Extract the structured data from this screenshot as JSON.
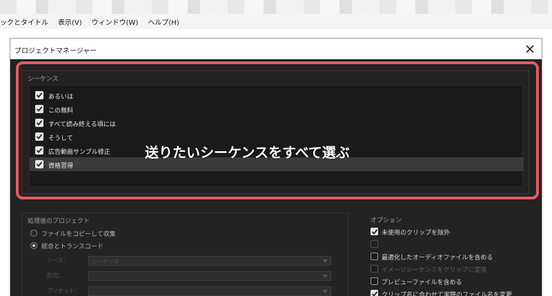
{
  "menu": {
    "items": [
      "ックとタイトル",
      "表示(V)",
      "ウィンドウ(W)",
      "ヘルプ(H)"
    ]
  },
  "dialog": {
    "title": "プロジェクトマネージャー",
    "sequence_group": {
      "title": "シーケンス",
      "items": [
        {
          "label": "あるいは",
          "checked": true,
          "selected": false
        },
        {
          "label": "この無料",
          "checked": true,
          "selected": false
        },
        {
          "label": "すべて読み終える頃には",
          "checked": true,
          "selected": false
        },
        {
          "label": "そうして",
          "checked": true,
          "selected": false
        },
        {
          "label": "広告動画サンプル修正",
          "checked": true,
          "selected": false
        },
        {
          "label": "資格習得",
          "checked": true,
          "selected": true
        }
      ]
    },
    "project_group": {
      "title": "処理後のプロジェクト",
      "radios": [
        {
          "label": "ファイルをコピーして収集",
          "selected": false
        },
        {
          "label": "統合とトランスコード",
          "selected": true
        }
      ],
      "fields": [
        {
          "label": "ソース：",
          "value": "シーケンス"
        },
        {
          "label": "形式：",
          "value": ""
        },
        {
          "label": "プリセット：",
          "value": ""
        }
      ]
    },
    "options_group": {
      "title": "オプション",
      "items": [
        {
          "label": "未使用のクリップを除外",
          "checked": true,
          "enabled": true
        },
        {
          "label": "",
          "checked": false,
          "enabled": false
        },
        {
          "label": "最適化したオーディオファイルを含める",
          "checked": false,
          "enabled": true
        },
        {
          "label": "イメージシーケンスをクリップに変換",
          "checked": false,
          "enabled": false
        },
        {
          "label": "プレビューファイルを含める",
          "checked": false,
          "enabled": true
        },
        {
          "label": "クリップ名に合わせて実際のファイル名を変更",
          "checked": true,
          "enabled": true
        }
      ]
    }
  },
  "overlay_caption": "送りたいシーケンスをすべて選ぶ",
  "colors": {
    "highlight": "#e85a65",
    "dialog_bg": "#232323",
    "list_bg": "#1a1a1a",
    "selected_row": "#3b3b3b"
  }
}
